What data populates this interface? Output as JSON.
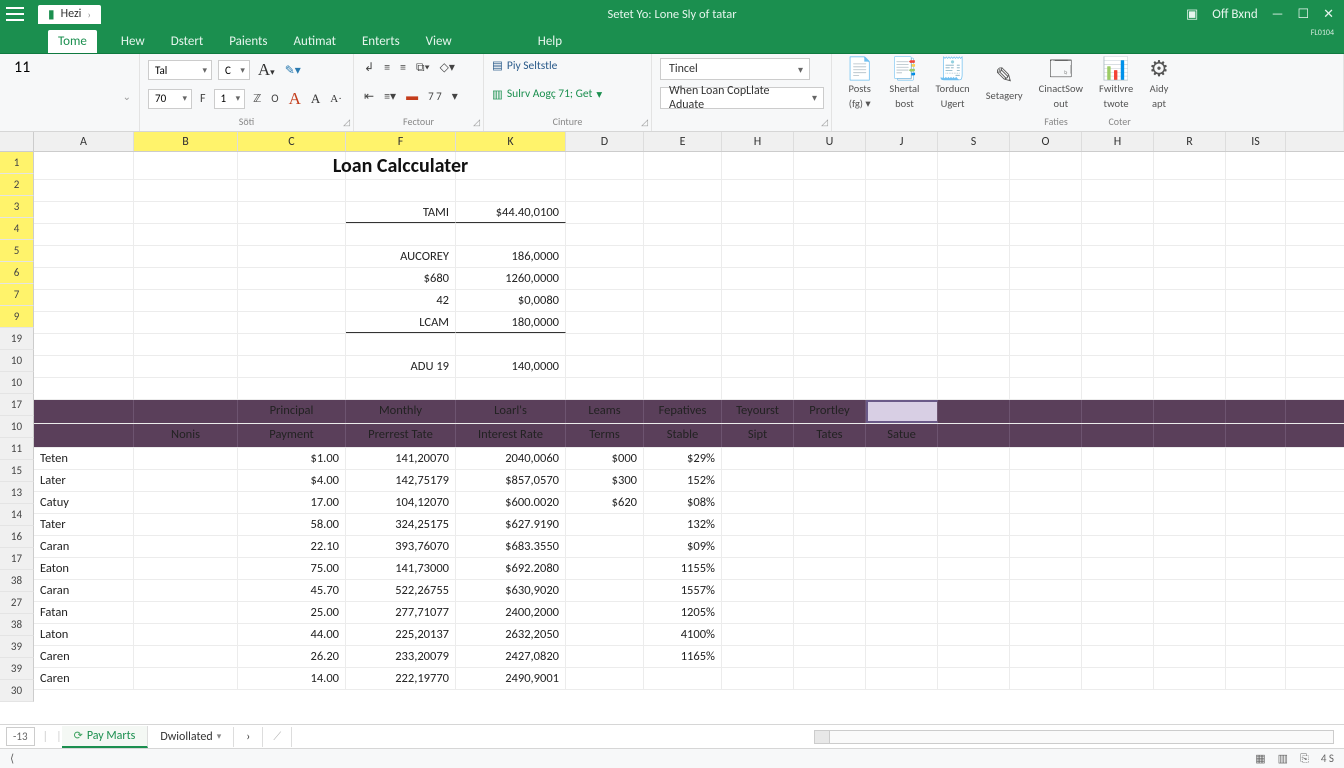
{
  "window": {
    "doc_title": "Setet Yo: Lone Sly of tatar",
    "off_brand": "Off Bxnd",
    "badge": "FL0104",
    "file_tab": "Hezi"
  },
  "menu": [
    "Tome",
    "Hew",
    "Dstert",
    "Paients",
    "Autimat",
    "Enterts",
    "View",
    "Help"
  ],
  "ribbon": {
    "font_name": "Tal",
    "font_size_sel": "C",
    "nb_left": "11",
    "nb_right": "70",
    "f_label": "F",
    "one": "1",
    "z_label": "ℤ",
    "o_label": "O",
    "grp1": "Sӧti",
    "grp2": "Fectour",
    "grp3": "Cinture",
    "grp4": "Faties",
    "grp5": "Coter",
    "pay": "Piy Seltstle",
    "sulr": "Sulrv Aogç 71; Get",
    "tincel": "Tincel",
    "when": "When Loan CopLlate Aduate",
    "btns": [
      {
        "ic": "📄",
        "l1": "Posts",
        "l2": "(fg) ▾"
      },
      {
        "ic": "📑",
        "l1": "Shertal",
        "l2": "bost"
      },
      {
        "ic": "🧾",
        "l1": "Torducn",
        "l2": "Ugert"
      },
      {
        "ic": "✎",
        "l1": "Setagery",
        "l2": ""
      },
      {
        "ic": "🗔",
        "l1": "CinactSow",
        "l2": "out"
      },
      {
        "ic": "📊",
        "l1": "Fwitlvre",
        "l2": "twote"
      },
      {
        "ic": "⚙",
        "l1": "Aidy",
        "l2": "apt"
      }
    ]
  },
  "cols": [
    "A",
    "B",
    "C",
    "F",
    "K",
    "D",
    "E",
    "H",
    "U",
    "J",
    "S",
    "O",
    "H",
    "R",
    "IS"
  ],
  "col_hl": [
    1,
    2,
    3,
    4
  ],
  "rownums": [
    "1",
    "2",
    "3",
    "4",
    "5",
    "6",
    "7",
    "9",
    "19",
    "10",
    "10",
    "17",
    "10",
    "11",
    "15",
    "13",
    "14",
    "16",
    "17",
    "38",
    "27",
    "38",
    "39",
    "39",
    "30"
  ],
  "row_hl": [
    0,
    1,
    2,
    3,
    4,
    5,
    6,
    7
  ],
  "calc": {
    "title": "Loan Calcculater",
    "rows": [
      {
        "lbl": "TAMI",
        "val": "$44.40,0100",
        "uline": true
      },
      {
        "lbl": "AUCOREY",
        "val": "186,0000"
      },
      {
        "lbl": "$680",
        "val": "1260,0000"
      },
      {
        "lbl": "42",
        "val": "$0,0080"
      },
      {
        "lbl": "LCAM",
        "val": "180,0000",
        "uline": true
      },
      {
        "lbl": "ADU 19",
        "val": "140,0000"
      }
    ]
  },
  "thead": [
    "",
    "Nonis",
    "Principal Payment",
    "Monthly Prerrest Tate",
    "Loarl's Interest Rate",
    "Leams Terms",
    "Fepatives Stable",
    "Teyourst Sipt",
    "Prortley Tates",
    "Satue"
  ],
  "trows": [
    [
      "Teten",
      "",
      "$1.00",
      "141,20070",
      "2040,0060",
      "$000",
      "$29%",
      "",
      "",
      ""
    ],
    [
      "Later",
      "",
      "$4.00",
      "142,75179",
      "$857,0570",
      "$300",
      "152%",
      "",
      "",
      ""
    ],
    [
      "Catuy",
      "",
      "17.00",
      "104,12070",
      "$600.0020",
      "$620",
      "$08%",
      "",
      "",
      ""
    ],
    [
      "Tater",
      "",
      "58.00",
      "324,25175",
      "$627.9190",
      "",
      "132%",
      "",
      "",
      ""
    ],
    [
      "Caran",
      "",
      "22.10",
      "393,76070",
      "$683.3550",
      "",
      "$09%",
      "",
      "",
      ""
    ],
    [
      "Eaton",
      "",
      "75.00",
      "141,73000",
      "$692.2080",
      "",
      "1155%",
      "",
      "",
      ""
    ],
    [
      "Caran",
      "",
      "45.70",
      "522,26755",
      "$630,9020",
      "",
      "1557%",
      "",
      "",
      ""
    ],
    [
      "Fatan",
      "",
      "25.00",
      "277,71077",
      "2400,2000",
      "",
      "1205%",
      "",
      "",
      ""
    ],
    [
      "Laton",
      "",
      "44.00",
      "225,20137",
      "2632,2050",
      "",
      "4100%",
      "",
      "",
      ""
    ],
    [
      "Caren",
      "",
      "26.20",
      "233,20079",
      "2427,0820",
      "",
      "1165%",
      "",
      "",
      ""
    ],
    [
      "Caren",
      "",
      "14.00",
      "222,19770",
      "2490,9001",
      "",
      "",
      "",
      "",
      ""
    ]
  ],
  "sheets": {
    "idx": "-13",
    "active": "Pay Marts",
    "second": "Dwiollated"
  },
  "status_right": "4 S",
  "chart_data": {
    "type": "table",
    "title": "Loan Calcculater",
    "summary": [
      {
        "label": "TAMI",
        "value": "$44.40,0100"
      },
      {
        "label": "AUCOREY",
        "value": "186,0000"
      },
      {
        "label": "$680",
        "value": "1260,0000"
      },
      {
        "label": "42",
        "value": "$0,0080"
      },
      {
        "label": "LCAM",
        "value": "180,0000"
      },
      {
        "label": "ADU 19",
        "value": "140,0000"
      }
    ],
    "columns": [
      "Nonis",
      "Principal Payment",
      "Monthly Prerrest Tate",
      "Loarl's Interest Rate",
      "Leams Terms",
      "Fepatives Stable",
      "Teyourst Sipt",
      "Prortley Tates",
      "Satue"
    ],
    "rows": [
      [
        "Teten",
        "$1.00",
        "141,20070",
        "2040,0060",
        "$000",
        "$29%",
        "",
        "",
        ""
      ],
      [
        "Later",
        "$4.00",
        "142,75179",
        "$857,0570",
        "$300",
        "152%",
        "",
        "",
        ""
      ],
      [
        "Catuy",
        "17.00",
        "104,12070",
        "$600.0020",
        "$620",
        "$08%",
        "",
        "",
        ""
      ],
      [
        "Tater",
        "58.00",
        "324,25175",
        "$627.9190",
        "",
        "132%",
        "",
        "",
        ""
      ],
      [
        "Caran",
        "22.10",
        "393,76070",
        "$683.3550",
        "",
        "$09%",
        "",
        "",
        ""
      ],
      [
        "Eaton",
        "75.00",
        "141,73000",
        "$692.2080",
        "",
        "1155%",
        "",
        "",
        ""
      ],
      [
        "Caran",
        "45.70",
        "522,26755",
        "$630,9020",
        "",
        "1557%",
        "",
        "",
        ""
      ],
      [
        "Fatan",
        "25.00",
        "277,71077",
        "2400,2000",
        "",
        "1205%",
        "",
        "",
        ""
      ],
      [
        "Laton",
        "44.00",
        "225,20137",
        "2632,2050",
        "",
        "4100%",
        "",
        "",
        ""
      ],
      [
        "Caren",
        "26.20",
        "233,20079",
        "2427,0820",
        "",
        "1165%",
        "",
        "",
        ""
      ],
      [
        "Caren",
        "14.00",
        "222,19770",
        "2490,9001",
        "",
        "",
        "",
        "",
        ""
      ]
    ]
  }
}
